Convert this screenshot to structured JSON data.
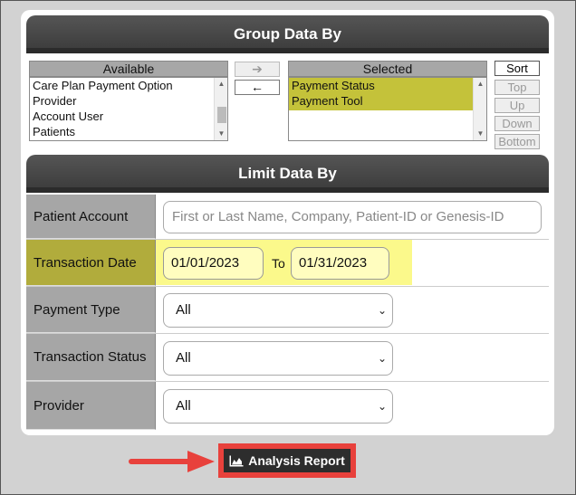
{
  "group": {
    "title": "Group Data By",
    "available_label": "Available",
    "selected_label": "Selected",
    "available_items": [
      "Care Plan Payment Option",
      "Provider",
      "Account User",
      "Patients"
    ],
    "selected_items": [
      "Payment Status",
      "Payment Tool"
    ],
    "move_right": "➔",
    "move_left": "🡐",
    "sort_label": "Sort",
    "up_top_label": "Top",
    "up_label": "Up",
    "down_label": "Down",
    "bottom_label": "Bottom"
  },
  "limit": {
    "title": "Limit Data By",
    "patient_account": {
      "label": "Patient Account",
      "placeholder": "First or Last Name, Company, Patient-ID or Genesis-ID"
    },
    "transaction_date": {
      "label": "Transaction Date",
      "from": "01/01/2023",
      "to_label": "To",
      "to": "01/31/2023"
    },
    "payment_type": {
      "label": "Payment Type",
      "value": "All"
    },
    "transaction_status": {
      "label": "Transaction Status",
      "value": "All"
    },
    "provider": {
      "label": "Provider",
      "value": "All"
    }
  },
  "actions": {
    "analysis_report": "Analysis Report"
  },
  "colors": {
    "highlight_yellow": "#fbf98b",
    "selected_olive": "#c4c23a",
    "annotation_red": "#e8413c"
  }
}
